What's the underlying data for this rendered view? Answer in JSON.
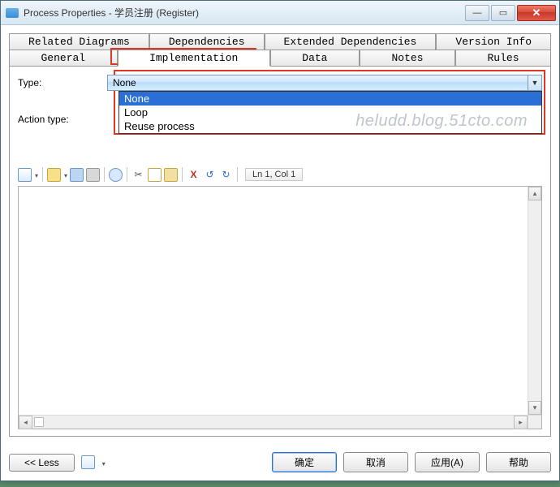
{
  "window": {
    "title": "Process Properties - 学员注册 (Register)"
  },
  "tabs_row1": [
    "Related Diagrams",
    "Dependencies",
    "Extended Dependencies",
    "Version Info"
  ],
  "tabs_row2": [
    "General",
    "Implementation",
    "Data",
    "Notes",
    "Rules"
  ],
  "active_tab": "Implementation",
  "fields": {
    "type_label": "Type:",
    "type_value": "None",
    "action_type_label": "Action type:"
  },
  "type_options": [
    "None",
    "Loop",
    "Reuse process"
  ],
  "toolbar": {
    "status": "Ln 1, Col 1"
  },
  "footer": {
    "less": "<< Less",
    "ok": "确定",
    "cancel": "取消",
    "apply": "应用(A)",
    "help": "帮助"
  },
  "watermark": "heludd.blog.51cto.com"
}
